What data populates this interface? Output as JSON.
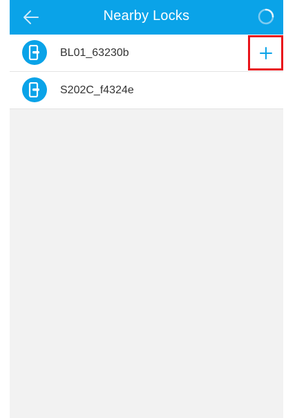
{
  "header": {
    "title": "Nearby Locks",
    "back_icon": "arrow-left-icon",
    "refresh_icon": "loading-spinner-icon"
  },
  "locks": [
    {
      "name": "BL01_63230b",
      "icon": "door-lock-icon",
      "action_icon": "plus-icon",
      "action_label": "+"
    },
    {
      "name": "S202C_f4324e",
      "icon": "door-lock-icon"
    }
  ],
  "colors": {
    "accent": "#0aa3e8",
    "highlight_border": "#e8141b",
    "background": "#f2f2f2"
  }
}
